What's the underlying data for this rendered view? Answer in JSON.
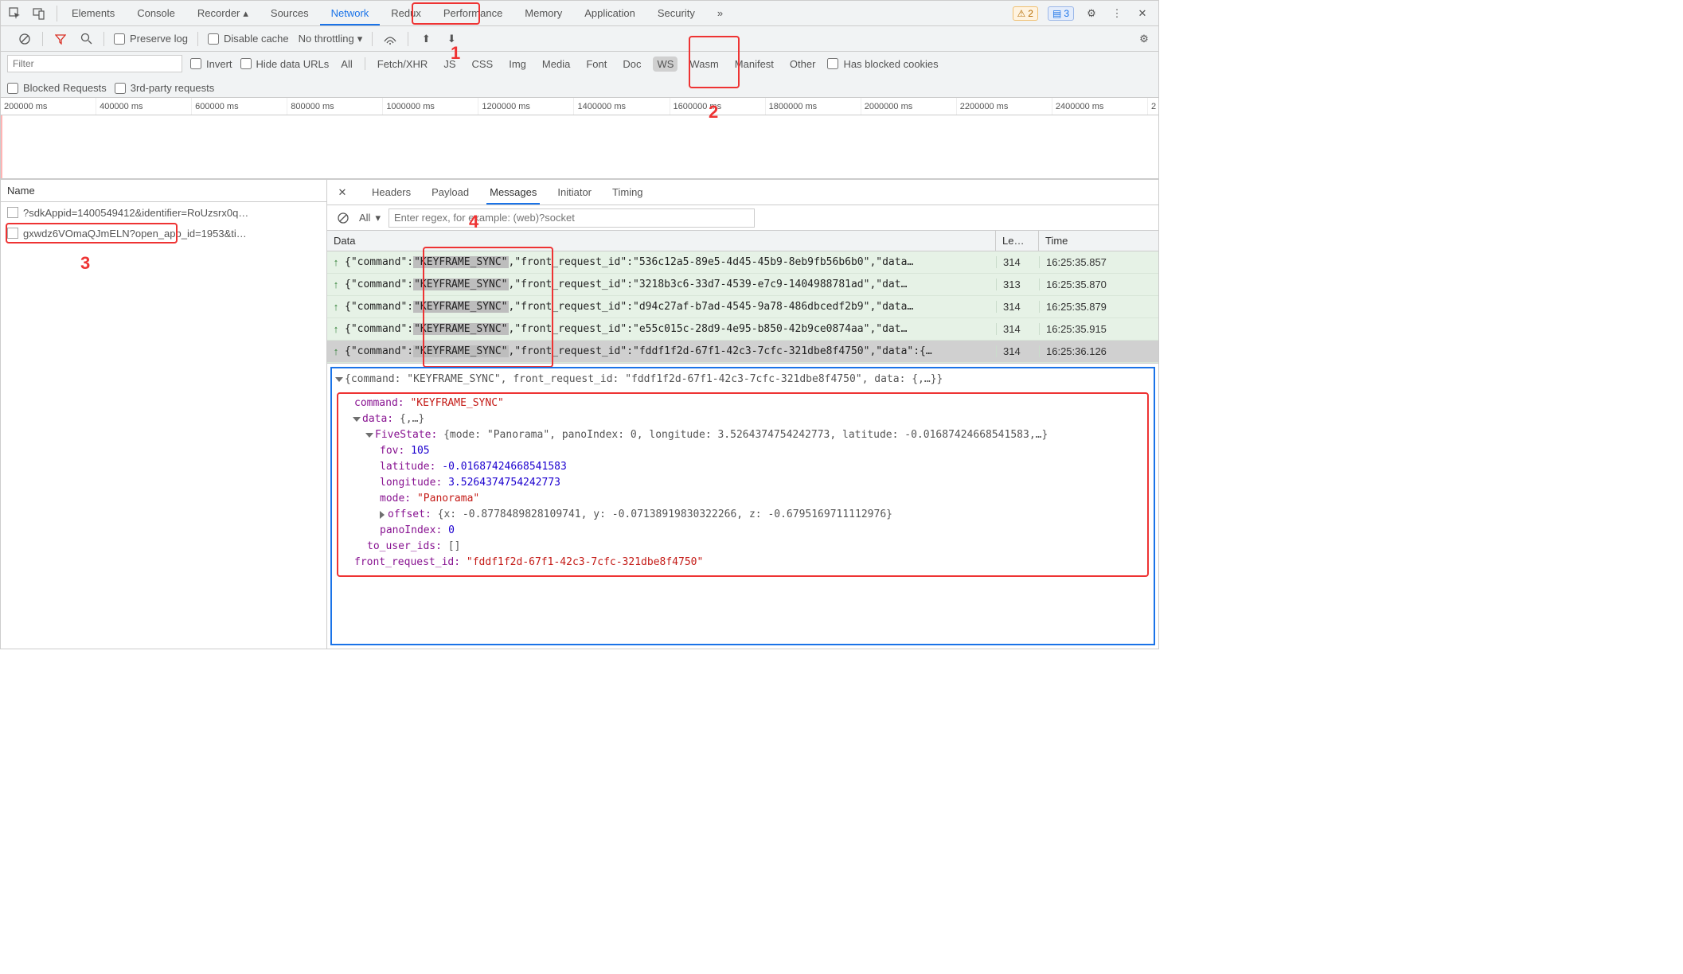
{
  "annotations": {
    "n1": "1",
    "n2": "2",
    "n3": "3",
    "n4": "4"
  },
  "top_tabs": {
    "elements": "Elements",
    "console": "Console",
    "recorder": "Recorder",
    "sources": "Sources",
    "network": "Network",
    "redux": "Redux",
    "performance": "Performance",
    "memory": "Memory",
    "application": "Application",
    "security": "Security",
    "more": "»"
  },
  "top_right": {
    "warn_count": "2",
    "info_count": "3"
  },
  "toolbar": {
    "preserve": "Preserve log",
    "disable_cache": "Disable cache",
    "throttle": "No throttling"
  },
  "filterbar": {
    "filter_ph": "Filter",
    "invert": "Invert",
    "hide_urls": "Hide data URLs",
    "pills": {
      "all": "All",
      "fetch": "Fetch/XHR",
      "js": "JS",
      "css": "CSS",
      "img": "Img",
      "media": "Media",
      "font": "Font",
      "doc": "Doc",
      "ws": "WS",
      "wasm": "Wasm",
      "manifest": "Manifest",
      "other": "Other"
    },
    "blocked_cookies": "Has blocked cookies",
    "blocked_req": "Blocked Requests",
    "third_party": "3rd-party requests"
  },
  "ruler": [
    "200000 ms",
    "400000 ms",
    "600000 ms",
    "800000 ms",
    "1000000 ms",
    "1200000 ms",
    "1400000 ms",
    "1600000 ms",
    "1800000 ms",
    "2000000 ms",
    "2200000 ms",
    "2400000 ms",
    "2"
  ],
  "left": {
    "header": "Name",
    "rows": [
      "?sdkAppid=1400549412&identifier=RoUzsrx0q…",
      "gxwdz6VOmaQJmELN?open_app_id=1953&ti…"
    ]
  },
  "rp_tabs": {
    "headers": "Headers",
    "payload": "Payload",
    "messages": "Messages",
    "initiator": "Initiator",
    "timing": "Timing"
  },
  "rp_filter": {
    "all": "All",
    "regex_ph": "Enter regex, for example: (web)?socket"
  },
  "msg_head": {
    "data": "Data",
    "len": "Le…",
    "time": "Time"
  },
  "messages": [
    {
      "dir": "up",
      "pre": "{\"command\":",
      "cmd": "\"KEYFRAME_SYNC\"",
      "post": ",\"front_request_id\":\"536c12a5-89e5-4d45-45b9-8eb9fb56b6b0\",\"data…",
      "len": "314",
      "time": "16:25:35.857"
    },
    {
      "dir": "up",
      "pre": "{\"command\":",
      "cmd": "\"KEYFRAME_SYNC\"",
      "post": ",\"front_request_id\":\"3218b3c6-33d7-4539-e7c9-1404988781ad\",\"dat…",
      "len": "313",
      "time": "16:25:35.870"
    },
    {
      "dir": "up",
      "pre": "{\"command\":",
      "cmd": "\"KEYFRAME_SYNC\"",
      "post": ",\"front_request_id\":\"d94c27af-b7ad-4545-9a78-486dbcedf2b9\",\"data…",
      "len": "314",
      "time": "16:25:35.879"
    },
    {
      "dir": "up",
      "pre": "{\"command\":",
      "cmd": "\"KEYFRAME_SYNC\"",
      "post": ",\"front_request_id\":\"e55c015c-28d9-4e95-b850-42b9ce0874aa\",\"dat…",
      "len": "314",
      "time": "16:25:35.915"
    },
    {
      "dir": "up",
      "pre": "{\"command\":",
      "cmd": "\"KEYFRAME_SYNC\"",
      "post": ",\"front_request_id\":\"fddf1f2d-67f1-42c3-7cfc-321dbe8f4750\",\"data\":{…",
      "len": "314",
      "time": "16:25:36.126"
    }
  ],
  "detail": {
    "line_top": "{command: \"KEYFRAME_SYNC\", front_request_id: \"fddf1f2d-67f1-42c3-7cfc-321dbe8f4750\", data: {,…}}",
    "command_k": "command:",
    "command_v": "\"KEYFRAME_SYNC\"",
    "data_k": "data:",
    "data_v": "{,…}",
    "five_k": "FiveState:",
    "five_v": "{mode: \"Panorama\", panoIndex: 0, longitude: 3.5264374754242773, latitude: -0.01687424668541583,…}",
    "fov_k": "fov:",
    "fov_v": "105",
    "lat_k": "latitude:",
    "lat_v": "-0.01687424668541583",
    "lon_k": "longitude:",
    "lon_v": "3.5264374754242773",
    "mode_k": "mode:",
    "mode_v": "\"Panorama\"",
    "off_k": "offset:",
    "off_v": "{x: -0.8778489828109741, y: -0.07138919830322266, z: -0.6795169711112976}",
    "pano_k": "panoIndex:",
    "pano_v": "0",
    "tou_k": "to_user_ids:",
    "tou_v": "[]",
    "frid_k": "front_request_id:",
    "frid_v": "\"fddf1f2d-67f1-42c3-7cfc-321dbe8f4750\""
  }
}
